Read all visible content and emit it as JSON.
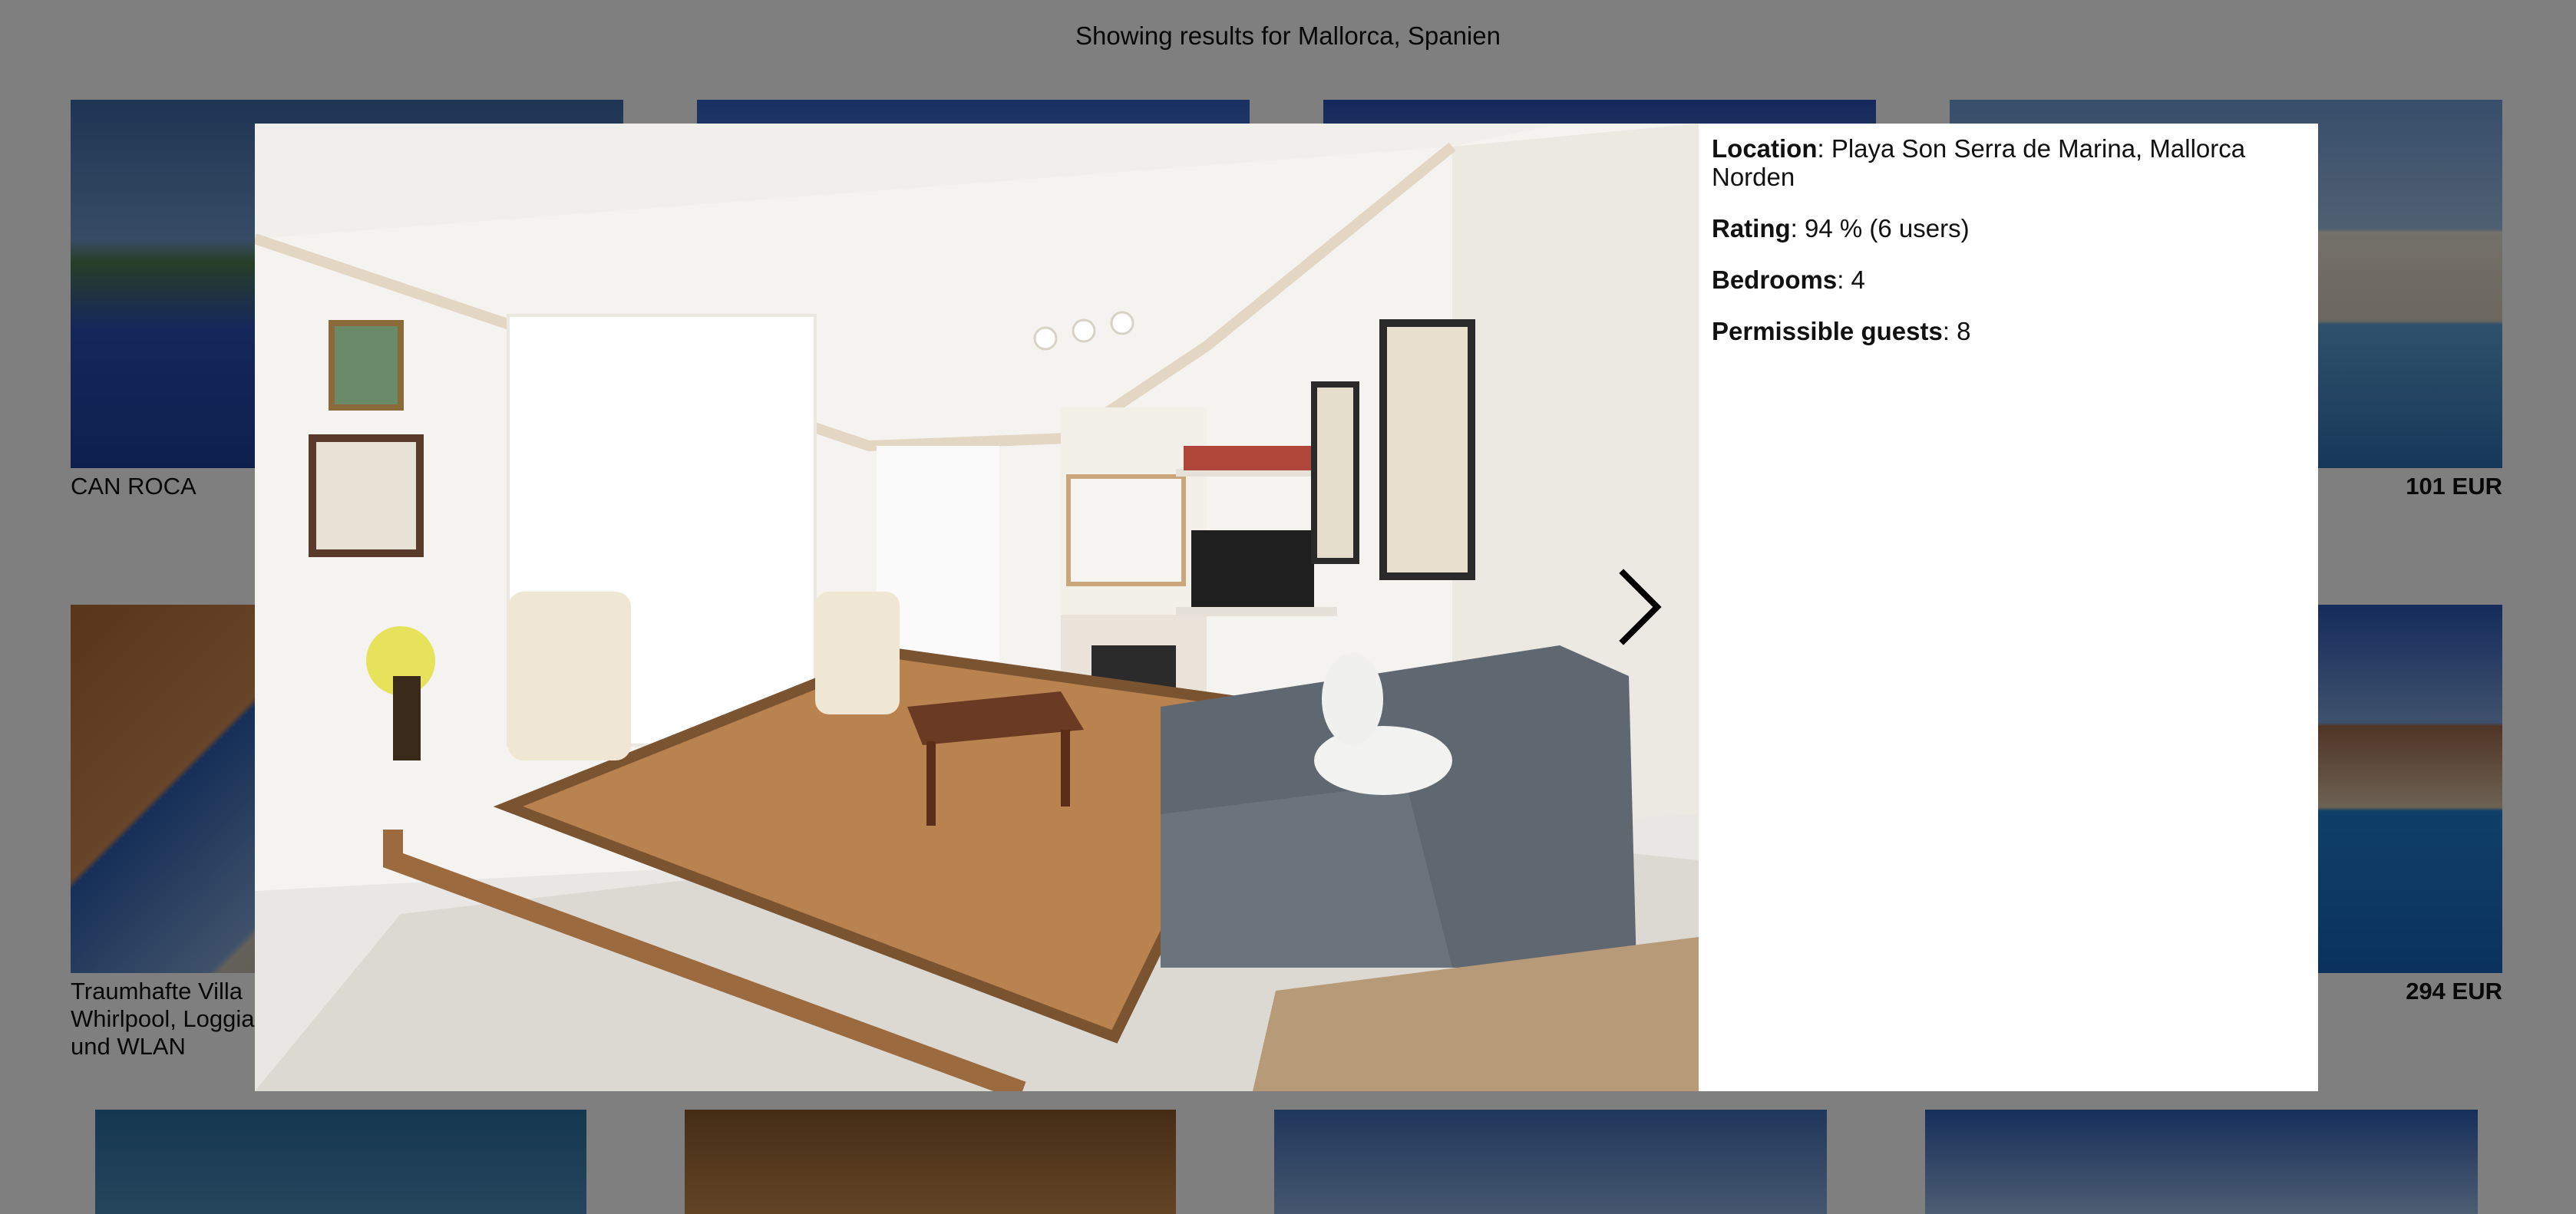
{
  "header": {
    "results_text": "Showing results for Mallorca, Spanien"
  },
  "listings": [
    {
      "title": "CAN ROCA",
      "price": ""
    },
    {
      "title": "",
      "price": "101 EUR"
    },
    {
      "title": "Traumhafte Villa Whirlpool, Loggia und WLAN",
      "title_lines": [
        "Traumhafte Villa",
        "Whirlpool, Loggia",
        "und WLAN"
      ],
      "price": ""
    },
    {
      "title": "",
      "price": "294 EUR"
    }
  ],
  "modal": {
    "details": [
      {
        "label": "Location",
        "value": "Playa Son Serra de Marina, Mallorca Norden"
      },
      {
        "label": "Rating",
        "value": "94 % (6 users)"
      },
      {
        "label": "Bedrooms",
        "value": "4"
      },
      {
        "label": "Permissible guests",
        "value": "8"
      }
    ],
    "next_icon": "chevron-right-icon"
  }
}
